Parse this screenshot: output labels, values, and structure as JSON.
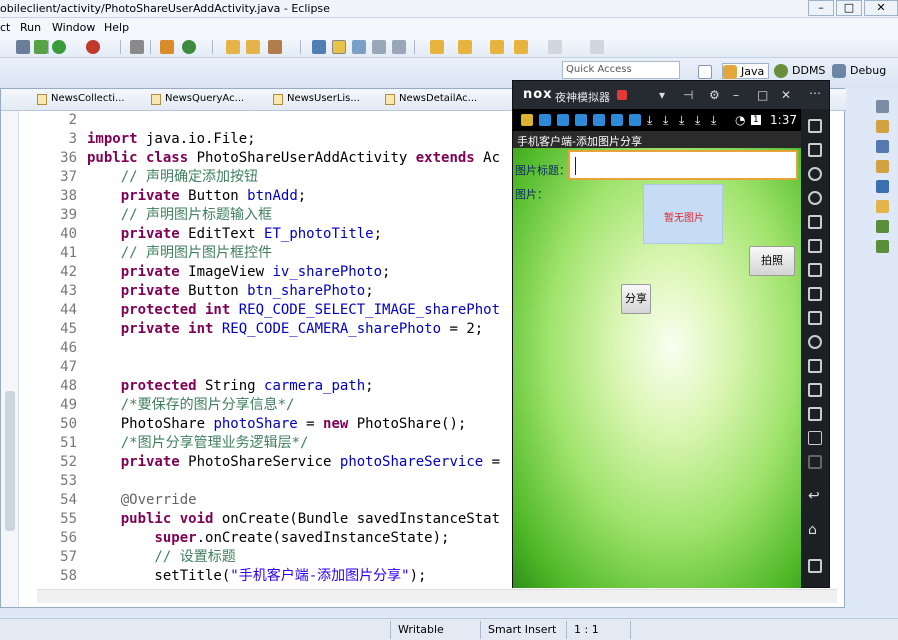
{
  "window": {
    "title": "obileclient/activity/PhotoShareUserAddActivity.java - Eclipse",
    "controls": [
      "–",
      "□",
      "✕"
    ]
  },
  "menu": [
    "ct",
    "Run",
    "Window",
    "Help"
  ],
  "quick_access": {
    "placeholder": "Quick Access"
  },
  "perspectives": [
    "Java",
    "DDMS",
    "Debug"
  ],
  "editor_tabs": [
    "NewsCollecti...",
    "NewsQueryAc...",
    "NewsUserLis...",
    "NewsDetailAc..."
  ],
  "code_lines": [
    {
      "n": "2",
      "t": ""
    },
    {
      "n": "3",
      "t": "import java.io.File;"
    },
    {
      "n": "36",
      "t": "public class PhotoShareUserAddActivity extends Ac"
    },
    {
      "n": "37",
      "t": "    // 声明确定添加按钮"
    },
    {
      "n": "38",
      "t": "    private Button btnAdd;"
    },
    {
      "n": "39",
      "t": "    // 声明图片标题输入框"
    },
    {
      "n": "40",
      "t": "    private EditText ET_photoTitle;"
    },
    {
      "n": "41",
      "t": "    // 声明图片图片框控件"
    },
    {
      "n": "42",
      "t": "    private ImageView iv_sharePhoto;"
    },
    {
      "n": "43",
      "t": "    private Button btn_sharePhoto;"
    },
    {
      "n": "44",
      "t": "    protected int REQ_CODE_SELECT_IMAGE_sharePhot"
    },
    {
      "n": "45",
      "t": "    private int REQ_CODE_CAMERA_sharePhoto = 2;"
    },
    {
      "n": "46",
      "t": ""
    },
    {
      "n": "47",
      "t": ""
    },
    {
      "n": "48",
      "t": "    protected String carmera_path;"
    },
    {
      "n": "49",
      "t": "    /*要保存的图片分享信息*/"
    },
    {
      "n": "50",
      "t": "    PhotoShare photoShare = new PhotoShare();"
    },
    {
      "n": "51",
      "t": "    /*图片分享管理业务逻辑层*/"
    },
    {
      "n": "52",
      "t": "    private PhotoShareService photoShareService ="
    },
    {
      "n": "53",
      "t": ""
    },
    {
      "n": "54",
      "t": "    @Override"
    },
    {
      "n": "55",
      "t": "    public void onCreate(Bundle savedInstanceStat"
    },
    {
      "n": "56",
      "t": "        super.onCreate(savedInstanceState);"
    },
    {
      "n": "57",
      "t": "        // 设置标题"
    },
    {
      "n": "58",
      "t": "        setTitle(\"手机客户端-添加图片分享\");"
    }
  ],
  "status": {
    "writable": "Writable",
    "insert_mode": "Smart Insert",
    "position": "1 : 1"
  },
  "emulator": {
    "logo": "nox",
    "name": "夜神模拟器",
    "clock": "1:37",
    "battery": "1",
    "app_title": "手机客户端-添加图片分享",
    "photo_title_label": "图片标题：",
    "photo_title_value": "",
    "photo_label": "图片：",
    "placeholder_image_text": "暂无图片",
    "camera_button": "拍照",
    "share_button": "分享"
  },
  "colors": {
    "keyword": "#7f0055",
    "field": "#0000c0",
    "comment": "#3f7f5f",
    "string": "#2a00ff"
  }
}
